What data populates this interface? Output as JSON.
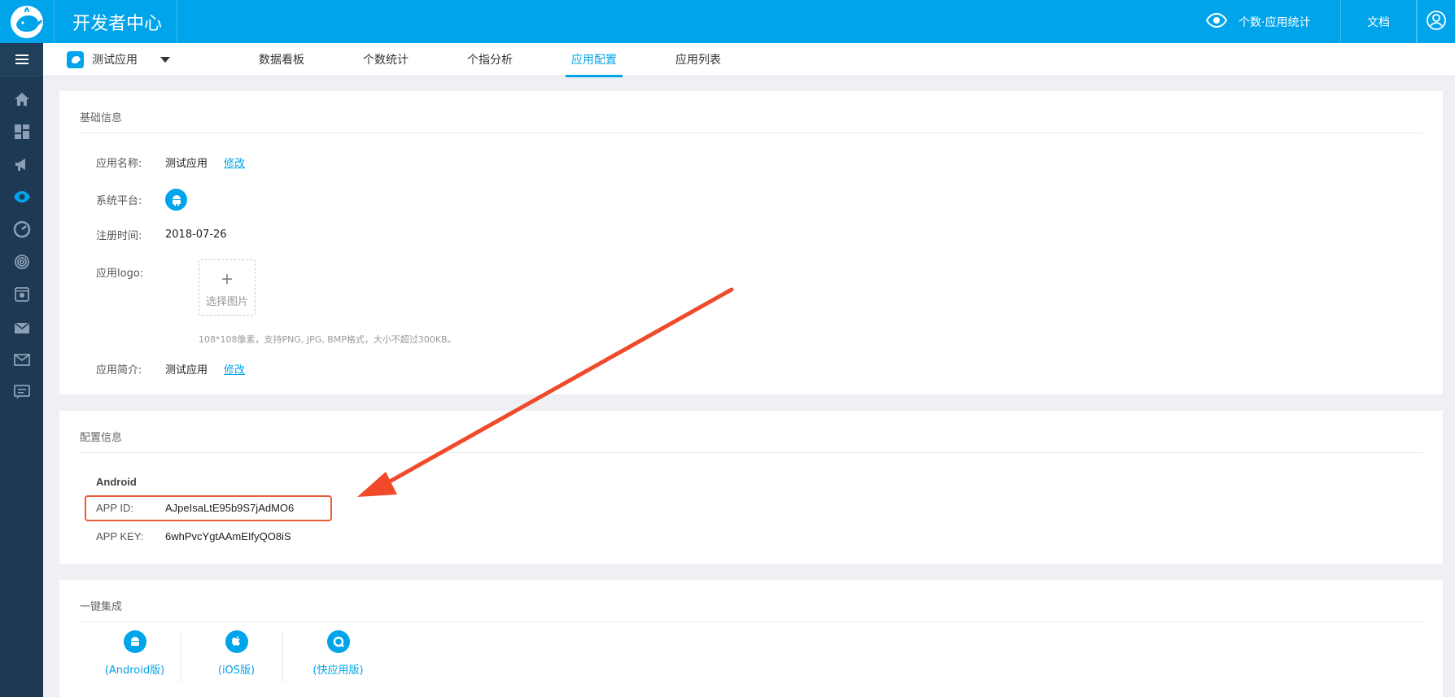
{
  "header": {
    "brand": "开发者中心",
    "stats_label": "个数·应用统计",
    "docs_label": "文档"
  },
  "subnav": {
    "app_name": "测试应用",
    "tabs": [
      {
        "label": "数据看板"
      },
      {
        "label": "个数统计"
      },
      {
        "label": "个指分析"
      },
      {
        "label": "应用配置",
        "active": true
      },
      {
        "label": "应用列表"
      }
    ]
  },
  "basic": {
    "title": "基础信息",
    "name_label": "应用名称:",
    "name_value": "测试应用",
    "edit": "修改",
    "platform_label": "系统平台:",
    "platform_icon": "android-icon",
    "reg_label": "注册时间:",
    "reg_value": "2018-07-26",
    "logo_label": "应用logo:",
    "logo_upload": "选择图片",
    "logo_hint": "108*108像素，支持PNG, JPG, BMP格式，大小不超过300KB。",
    "intro_label": "应用简介:",
    "intro_value": "测试应用"
  },
  "config": {
    "title": "配置信息",
    "platform": "Android",
    "appid_label": "APP ID:",
    "appid_value": "AJpeIsaLtE95b9S7jAdMO6",
    "appkey_label": "APP KEY:",
    "appkey_value": "6whPvcYgtAAmEIfyQO8iS"
  },
  "integration": {
    "title": "一键集成",
    "items": [
      {
        "label": "(Android版)",
        "icon": "android-icon"
      },
      {
        "label": "(iOS版)",
        "icon": "apple-icon"
      },
      {
        "label": "(快应用版)",
        "icon": "quickapp-icon"
      }
    ]
  },
  "colors": {
    "accent": "#00a4ea",
    "sidebar": "#1d3953",
    "annotation": "#e85d3a"
  }
}
